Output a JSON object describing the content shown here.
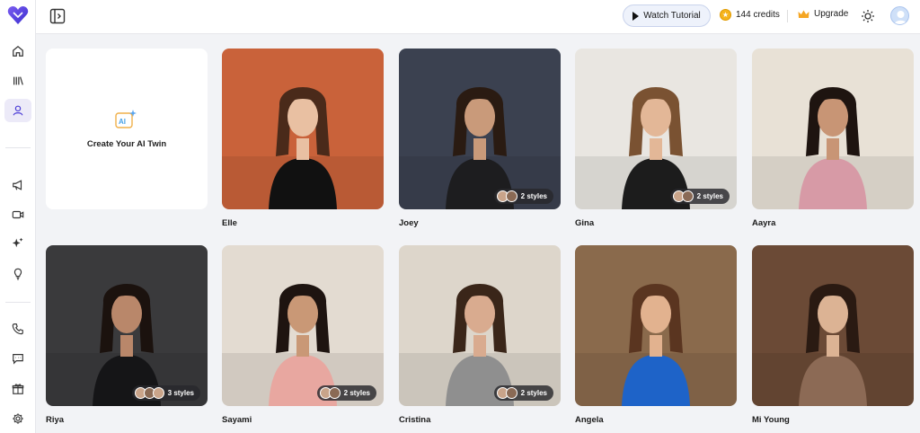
{
  "header": {
    "watch_tutorial": "Watch Tutorial",
    "credits": "144 credits",
    "upgrade": "Upgrade"
  },
  "sidebar": {
    "items": [
      {
        "icon": "home-icon"
      },
      {
        "icon": "library-icon"
      },
      {
        "icon": "user-icon",
        "active": true
      },
      {
        "icon": "megaphone-icon"
      },
      {
        "icon": "video-icon"
      },
      {
        "icon": "sparkle-icon"
      },
      {
        "icon": "lightbulb-icon"
      },
      {
        "icon": "phone-icon"
      },
      {
        "icon": "chat-icon"
      },
      {
        "icon": "gift-icon"
      },
      {
        "icon": "gear-icon"
      }
    ]
  },
  "create": {
    "label": "Create Your AI Twin"
  },
  "avatars": [
    {
      "name": "Elle",
      "styles": "",
      "bg": "#c9623a",
      "skin": "#e9c0a2",
      "hair": "#4a2a1a",
      "shirt": "#111111"
    },
    {
      "name": "Joey",
      "styles": "2 styles",
      "bg": "#3b4150",
      "skin": "#c99a7a",
      "hair": "#2a1b12",
      "shirt": "#1d1d1f"
    },
    {
      "name": "Gina",
      "styles": "2 styles",
      "bg": "#e9e6e1",
      "skin": "#e3b797",
      "hair": "#7a5232",
      "shirt": "#1c1c1c"
    },
    {
      "name": "Aayra",
      "styles": "",
      "bg": "#e8e1d6",
      "skin": "#c89575",
      "hair": "#1e1410",
      "shirt": "#d79aa6"
    },
    {
      "name": "Riya",
      "styles": "3 styles",
      "bg": "#3a3a3c",
      "skin": "#b9876a",
      "hair": "#1b120e",
      "shirt": "#151517"
    },
    {
      "name": "Sayami",
      "styles": "2 styles",
      "bg": "#e3dbd1",
      "skin": "#c99876",
      "hair": "#1e1410",
      "shirt": "#e8a7a0"
    },
    {
      "name": "Cristina",
      "styles": "2 styles",
      "bg": "#ddd6cb",
      "skin": "#d9ab8f",
      "hair": "#3a2619",
      "shirt": "#8f8f8f"
    },
    {
      "name": "Angela",
      "styles": "",
      "bg": "#8a6a4c",
      "skin": "#e2b28f",
      "hair": "#5a3520",
      "shirt": "#1e63c8"
    },
    {
      "name": "Mi Young",
      "styles": "",
      "bg": "#6b4a36",
      "skin": "#dcb394",
      "hair": "#2a1a12",
      "shirt": "#8c6a55"
    }
  ]
}
